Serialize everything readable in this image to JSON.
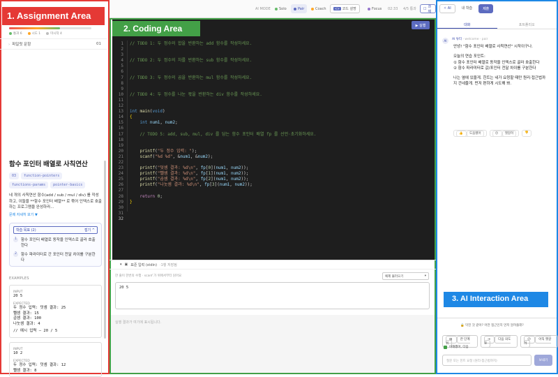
{
  "assignment": {
    "area_label": "1. Assignment Area",
    "progress": 0.62,
    "legend": [
      "통과 6",
      "시도 1",
      "미시작 4"
    ],
    "file_label": "파일럿 문항",
    "file_count": "01",
    "title": "함수 포인터 배열로 사칙연산",
    "tags": [
      "03",
      "function-pointers",
      "functions-params",
      "pointer-basics"
    ],
    "description": "네 개의 사칙연산 함수(add / sub / mul / div) 를 작성하고, 이들을 **함수 포인터 배열** 로 묶어 인덱스로 호출하는 프로그램을 완성하라...",
    "more_link": "문제 자세히 보기 ▼",
    "goals_title": "학습 목표 (2)",
    "goals_toggle": "접기 ^",
    "goals": [
      {
        "num": "1",
        "text": "함수 포인터 배열로 동작을 인덱스로 골라 호출한다"
      },
      {
        "num": "2",
        "text": "함수 파라미터로 간 포인터 전달 차이를 구분한다"
      }
    ],
    "examples_label": "EXAMPLES",
    "examples": [
      {
        "input_label": "INPUT",
        "input": "20 5",
        "expected_label": "EXPECTED",
        "expected": "두 정수 입력: 덧셈 결과: 25\n뺄셈 결과: 15\n곱셈 결과: 100\n나눗셈 결과: 4",
        "note": "// 예시 입력 — 20 / 5"
      },
      {
        "input_label": "INPUT",
        "input": "10 2",
        "expected_label": "EXPECTED",
        "expected": "두 정수 입력: 덧셈 결과: 12\n뺄셈 결과: 8"
      }
    ]
  },
  "toolbar": {
    "mode_label": "AI MODE",
    "solo": "Solo",
    "pair": "Pair",
    "coach": "Coach",
    "code_review": "코드 설명",
    "focus": "Focus",
    "time": "02:33",
    "progress": "4/5 통과",
    "task": "과제"
  },
  "coding": {
    "area_label": "2. Coding Area",
    "run_label": "▶ 실행",
    "line_numbers": [
      "1",
      "2",
      "3",
      "4",
      "5",
      "6",
      "7",
      "8",
      "9",
      "10",
      "11",
      "12",
      "13",
      "14",
      "15",
      "16",
      "17",
      "18",
      "19",
      "20",
      "21",
      "22",
      "23",
      "24",
      "25",
      "26",
      "27",
      "28",
      "29",
      "30",
      "31",
      "32"
    ],
    "stdin_label": "표준 입력 (stdin)",
    "stdin_note": "·1행 저장됨",
    "stdin_hint": "한 줄이 한번의 수행 · scanf 가 위에서부터 읽어요",
    "example_select": "예제 불러오기",
    "stdin_value": "20 5",
    "output_placeholder": "실행 결과가 여기에 표시됩니다."
  },
  "ai": {
    "area_label": "3. AI Interaction Area",
    "top_ai": "AI",
    "top_learn": "내 학습",
    "top_submit": "제출",
    "tabs": [
      "대화",
      "포트폴리오"
    ],
    "name": "AI 튜터",
    "name_sub": "· welcome · pair",
    "messages": [
      "안녕! \"함수 포인터 배열로 사칙연산\" 시작이구나.",
      "오늘의 연습 포인트:\n ① 함수 포인터 배열로 동작을 인덱스로 골라 호출한다\n ② 함수 파라미터로 값/포인터 전달 차이를 구분한다",
      "나는 옆에 있을게. 힌트는 네가 요청할 때만 원리·접근법까지 건네줄게. 먼저 편하게 시도해 봐."
    ],
    "reactions": [
      "도움됐어",
      "헷갈려",
      "👎"
    ],
    "hint_line": "🔒 막힌 것 같아? 어떤 접근인지 먼저 알려줄래?",
    "btn_step": "한 단계 위",
    "btn_next": "다음 의도로",
    "btn_stuck": "아직 헷갈려",
    "checkbox": "이해했어, 다음",
    "input_placeholder": "질문 또는 힌트 요청 (원리·접근법까지)",
    "send": "보내기"
  }
}
